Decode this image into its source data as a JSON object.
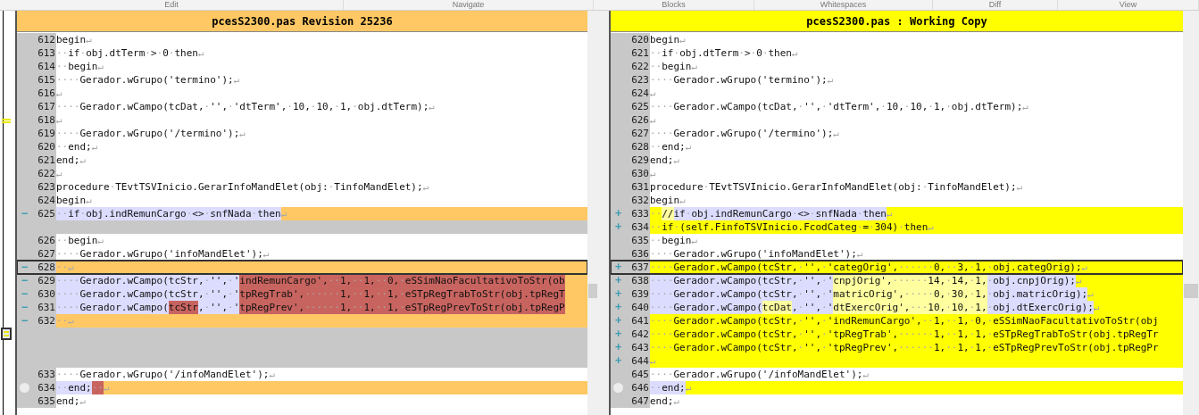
{
  "menu": [
    "Edit",
    "Navigate",
    "Blocks",
    "Whitespaces",
    "Diff",
    "View"
  ],
  "panels": [
    {
      "kind": "revision",
      "title": "pcesS2300.pas Revision 25236",
      "lines": [
        {
          "num": "612",
          "kind": "plain",
          "segments": [
            {
              "text": "begin↵"
            }
          ]
        },
        {
          "num": "613",
          "kind": "plain",
          "segments": [
            {
              "text": "··if·obj.dtTerm·>·0·then↵"
            }
          ]
        },
        {
          "num": "614",
          "kind": "plain",
          "segments": [
            {
              "text": "··begin↵"
            }
          ]
        },
        {
          "num": "615",
          "kind": "plain",
          "segments": [
            {
              "text": "····Gerador.wGrupo('termino');↵"
            }
          ]
        },
        {
          "num": "616",
          "kind": "plain",
          "segments": [
            {
              "text": "↵"
            }
          ]
        },
        {
          "num": "617",
          "kind": "plain",
          "segments": [
            {
              "text": "····Gerador.wCampo(tcDat,·'',·'dtTerm',·10,·10,·1,·obj.dtTerm);↵"
            }
          ]
        },
        {
          "num": "618",
          "kind": "plain",
          "segments": [
            {
              "text": "↵"
            }
          ]
        },
        {
          "num": "619",
          "kind": "plain",
          "segments": [
            {
              "text": "····Gerador.wGrupo('/termino');↵"
            }
          ]
        },
        {
          "num": "620",
          "kind": "plain",
          "segments": [
            {
              "text": "··end;↵"
            }
          ]
        },
        {
          "num": "621",
          "kind": "plain",
          "segments": [
            {
              "text": "end;↵"
            }
          ]
        },
        {
          "num": "622",
          "kind": "plain",
          "segments": [
            {
              "text": "↵"
            }
          ]
        },
        {
          "num": "623",
          "kind": "plain",
          "segments": [
            {
              "text": "procedure·TEvtTSVInicio.GerarInfoMandElet(obj:·TinfoMandElet);↵"
            }
          ]
        },
        {
          "num": "624",
          "kind": "plain",
          "segments": [
            {
              "text": "begin↵"
            }
          ]
        },
        {
          "num": "625",
          "kind": "changed",
          "sign": "−",
          "segments": [
            {
              "text": "··if·obj.indRemunCargo·<>·snfNada·then",
              "kind": "same"
            },
            {
              "text": "↵"
            }
          ]
        },
        {
          "kind": "filler"
        },
        {
          "num": "626",
          "kind": "plain",
          "segments": [
            {
              "text": "··begin↵"
            }
          ]
        },
        {
          "num": "627",
          "kind": "plain",
          "segments": [
            {
              "text": "····Gerador.wGrupo('infoMandElet');↵"
            }
          ]
        },
        {
          "num": "628",
          "kind": "changed",
          "sign": "−",
          "current_block": true,
          "segments": [
            {
              "text": "··↵"
            }
          ]
        },
        {
          "num": "629",
          "kind": "changed",
          "sign": "−",
          "segments": [
            {
              "text": "····Gerador.wCampo(tcStr,·'',·'",
              "kind": "same"
            },
            {
              "text": "indRemunCargo',··1,··1,··0,·eSSimNaoFacultativoToStr(ob",
              "kind": "diff"
            }
          ]
        },
        {
          "num": "630",
          "kind": "changed",
          "sign": "−",
          "segments": [
            {
              "text": "····Gerador.wCampo(tcStr,·'',·'",
              "kind": "same"
            },
            {
              "text": "tpRegTrab',······1,··1,··1,·eSTpRegTrabToStr(obj.tpRegT",
              "kind": "diff"
            }
          ]
        },
        {
          "num": "631",
          "kind": "changed",
          "sign": "−",
          "segments": [
            {
              "text": "····Gerador.wCampo(",
              "kind": "same"
            },
            {
              "text": "tcStr",
              "kind": "diff"
            },
            {
              "text": ",·'',·'",
              "kind": "same"
            },
            {
              "text": "tpRegPrev',······1,··1,··1,·eSTpRegPrevToStr(obj.tpRegP",
              "kind": "diff"
            }
          ]
        },
        {
          "num": "632",
          "kind": "changed",
          "sign": "−",
          "segments": [
            {
              "text": "··↵"
            }
          ]
        },
        {
          "kind": "filler"
        },
        {
          "kind": "filler"
        },
        {
          "kind": "filler"
        },
        {
          "num": "633",
          "kind": "plain",
          "segments": [
            {
              "text": "····Gerador.wGrupo('/infoMandElet');↵"
            }
          ]
        },
        {
          "num": "634",
          "kind": "changed",
          "bookmark": true,
          "segments": [
            {
              "text": "··end;",
              "kind": "same"
            },
            {
              "text": "··",
              "kind": "diff"
            },
            {
              "text": "↵"
            }
          ]
        },
        {
          "num": "635",
          "kind": "plain",
          "segments": [
            {
              "text": "end;↵"
            }
          ]
        }
      ]
    },
    {
      "kind": "working",
      "title": "pcesS2300.pas : Working Copy",
      "lines": [
        {
          "num": "620",
          "kind": "plain",
          "segments": [
            {
              "text": "begin↵"
            }
          ]
        },
        {
          "num": "621",
          "kind": "plain",
          "segments": [
            {
              "text": "··if·obj.dtTerm·>·0·then↵"
            }
          ]
        },
        {
          "num": "622",
          "kind": "plain",
          "segments": [
            {
              "text": "··begin↵"
            }
          ]
        },
        {
          "num": "623",
          "kind": "plain",
          "segments": [
            {
              "text": "····Gerador.wGrupo('termino');↵"
            }
          ]
        },
        {
          "num": "624",
          "kind": "plain",
          "segments": [
            {
              "text": "↵"
            }
          ]
        },
        {
          "num": "625",
          "kind": "plain",
          "segments": [
            {
              "text": "····Gerador.wCampo(tcDat,·'',·'dtTerm',·10,·10,·1,·obj.dtTerm);↵"
            }
          ]
        },
        {
          "num": "626",
          "kind": "plain",
          "segments": [
            {
              "text": "↵"
            }
          ]
        },
        {
          "num": "627",
          "kind": "plain",
          "segments": [
            {
              "text": "····Gerador.wGrupo('/termino');↵"
            }
          ]
        },
        {
          "num": "628",
          "kind": "plain",
          "segments": [
            {
              "text": "··end;↵"
            }
          ]
        },
        {
          "num": "629",
          "kind": "plain",
          "segments": [
            {
              "text": "end;↵"
            }
          ]
        },
        {
          "num": "630",
          "kind": "plain",
          "segments": [
            {
              "text": "↵"
            }
          ]
        },
        {
          "num": "631",
          "kind": "plain",
          "segments": [
            {
              "text": "procedure·TEvtTSVInicio.GerarInfoMandElet(obj:·TinfoMandElet);↵"
            }
          ]
        },
        {
          "num": "632",
          "kind": "plain",
          "segments": [
            {
              "text": "begin↵"
            }
          ]
        },
        {
          "num": "633",
          "kind": "changed",
          "sign": "+",
          "segments": [
            {
              "text": "··"
            },
            {
              "text": "//",
              "kind": "diff"
            },
            {
              "text": "if·obj.indRemunCargo·<>·snfNada·then",
              "kind": "same"
            },
            {
              "text": "↵"
            }
          ]
        },
        {
          "num": "634",
          "kind": "changed",
          "sign": "+",
          "segments": [
            {
              "text": "··if·(self.FinfoTSVInicio.FcodCateg·=·304)·then↵"
            }
          ]
        },
        {
          "num": "635",
          "kind": "plain",
          "segments": [
            {
              "text": "··begin↵"
            }
          ]
        },
        {
          "num": "636",
          "kind": "plain",
          "segments": [
            {
              "text": "····Gerador.wGrupo('infoMandElet');↵"
            }
          ]
        },
        {
          "num": "637",
          "kind": "changed",
          "sign": "+",
          "current_block": true,
          "segments": [
            {
              "text": "····Gerador.wCampo(tcStr,·'',·'categOrig',······0,··3,·1,·obj.categOrig);↵"
            }
          ]
        },
        {
          "num": "638",
          "kind": "changed",
          "sign": "+",
          "segments": [
            {
              "text": "····Gerador.wCampo(tcStr,·'',·'",
              "kind": "same"
            },
            {
              "text": "cnpjOrig',······14,·14,·1,",
              "kind": "diff"
            },
            {
              "text": "·obj.cnpjOrig);",
              "kind": "same"
            },
            {
              "text": "↵"
            }
          ]
        },
        {
          "num": "639",
          "kind": "changed",
          "sign": "+",
          "segments": [
            {
              "text": "····Gerador.wCampo(tcStr,·'',·'",
              "kind": "same"
            },
            {
              "text": "matricOrig',·····0,·30,·1,",
              "kind": "diff"
            },
            {
              "text": "·obj.matricOrig);",
              "kind": "same"
            },
            {
              "text": "↵"
            }
          ]
        },
        {
          "num": "640",
          "kind": "changed",
          "sign": "+",
          "segments": [
            {
              "text": "····Gerador.wCampo(",
              "kind": "same"
            },
            {
              "text": "tcDat",
              "kind": "diff"
            },
            {
              "text": ",·'',·'",
              "kind": "same"
            },
            {
              "text": "dtExercOrig',···10,·10,·1,",
              "kind": "diff"
            },
            {
              "text": "·obj.dtExercOrig);",
              "kind": "same"
            },
            {
              "text": "↵"
            }
          ]
        },
        {
          "num": "641",
          "kind": "changed",
          "sign": "+",
          "segments": [
            {
              "text": "····Gerador.wCampo(tcStr,·'',·'indRemunCargo',··1,··1,·0,·eSSimNaoFacultativoToStr(obj"
            }
          ]
        },
        {
          "num": "642",
          "kind": "changed",
          "sign": "+",
          "segments": [
            {
              "text": "····Gerador.wCampo(tcStr,·'',·'tpRegTrab',······1,··1,·1,·eSTpRegTrabToStr(obj.tpRegTr"
            }
          ]
        },
        {
          "num": "643",
          "kind": "changed",
          "sign": "+",
          "segments": [
            {
              "text": "····Gerador.wCampo(tcStr,·'',·'tpRegPrev',······1,··1,·1,·eSTpRegPrevToStr(obj.tpRegPr"
            }
          ]
        },
        {
          "num": "644",
          "kind": "changed",
          "sign": "+",
          "segments": [
            {
              "text": "↵"
            }
          ]
        },
        {
          "num": "645",
          "kind": "plain",
          "segments": [
            {
              "text": "····Gerador.wGrupo('/infoMandElet');↵"
            }
          ]
        },
        {
          "num": "646",
          "kind": "changed",
          "bookmark": true,
          "segments": [
            {
              "text": "··end;",
              "kind": "same"
            },
            {
              "text": "↵"
            }
          ]
        },
        {
          "num": "647",
          "kind": "plain",
          "segments": [
            {
              "text": "end;↵"
            }
          ]
        }
      ]
    }
  ]
}
